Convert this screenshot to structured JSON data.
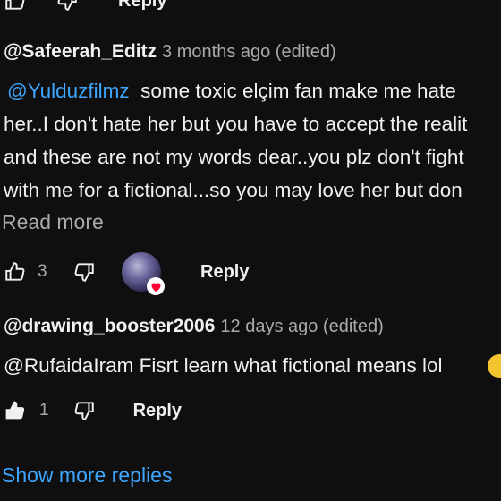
{
  "top_actions": {
    "reply_label": "Reply"
  },
  "comments": [
    {
      "handle": "@Safeerah_Editz",
      "time": "3 months ago (edited)",
      "mention": "@Yulduzfilmz",
      "lines": [
        "some toxic elçim fan make me hate",
        "her..I don't hate her but you have to accept the realit",
        "and these are not my words dear..you plz don't fight",
        "with me for a fictional...so you may love her but don"
      ],
      "read_more": "Read more",
      "like_count": "3",
      "reply_label": "Reply"
    },
    {
      "handle": "@drawing_booster2006",
      "time": "12 days ago (edited)",
      "text": "@RufaidaIram Fisrt learn what fictional means lol",
      "like_count": "1",
      "reply_label": "Reply"
    }
  ],
  "show_more_replies": "Show more replies",
  "icons": [
    "thumb-up-icon",
    "thumb-down-icon",
    "heart-icon",
    "laughing-emoji-icon"
  ]
}
